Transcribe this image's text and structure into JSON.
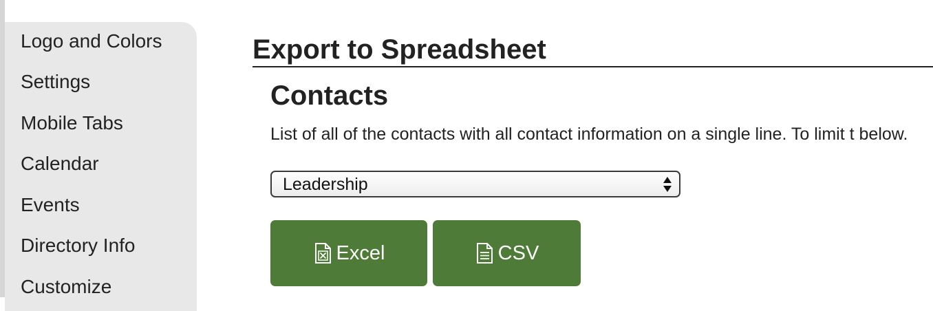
{
  "sidebar": {
    "items": [
      {
        "label": "Logo and Colors"
      },
      {
        "label": "Settings"
      },
      {
        "label": "Mobile Tabs"
      },
      {
        "label": "Calendar"
      },
      {
        "label": "Events"
      },
      {
        "label": "Directory Info"
      },
      {
        "label": "Customize"
      }
    ]
  },
  "main": {
    "title": "Export to Spreadsheet",
    "section": {
      "title": "Contacts",
      "description": "List of all of the contacts with all contact information on a single line. To limit t below."
    },
    "group_select": {
      "selected": "Leadership"
    },
    "buttons": {
      "excel_label": "Excel",
      "excel_icon": "excel-file-icon",
      "csv_label": "CSV",
      "csv_icon": "document-icon"
    }
  },
  "colors": {
    "button_green": "#4e7b37",
    "sidebar_bg": "#e8e8e8"
  }
}
